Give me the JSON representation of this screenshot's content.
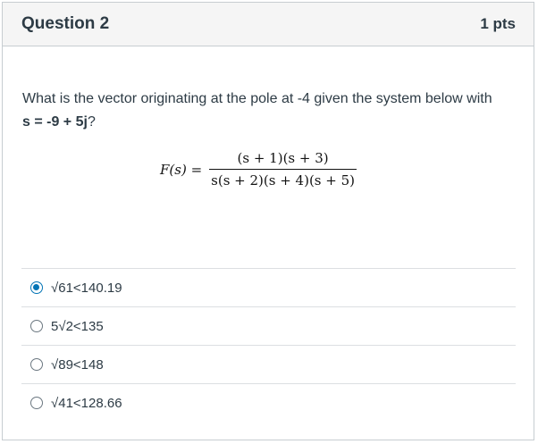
{
  "question": {
    "title": "Question 2",
    "points": "1 pts",
    "text_part1": "What is the vector originating at the pole at -4 given the system below with ",
    "text_bold": "s = -9 + 5j",
    "text_part2": "?"
  },
  "formula": {
    "lhs": "F(s) =",
    "numerator": "(s + 1)(s + 3)",
    "denominator": "s(s + 2)(s + 4)(s + 5)"
  },
  "answers": [
    {
      "label": "√61<140.19",
      "selected": true
    },
    {
      "label": "5√2<135",
      "selected": false
    },
    {
      "label": "√89<148",
      "selected": false
    },
    {
      "label": "√41<128.66",
      "selected": false
    }
  ],
  "colors": {
    "accent": "#0374b5",
    "header_bg": "#f5f5f5",
    "text": "#2d3b45",
    "border": "#c7cdd1"
  }
}
